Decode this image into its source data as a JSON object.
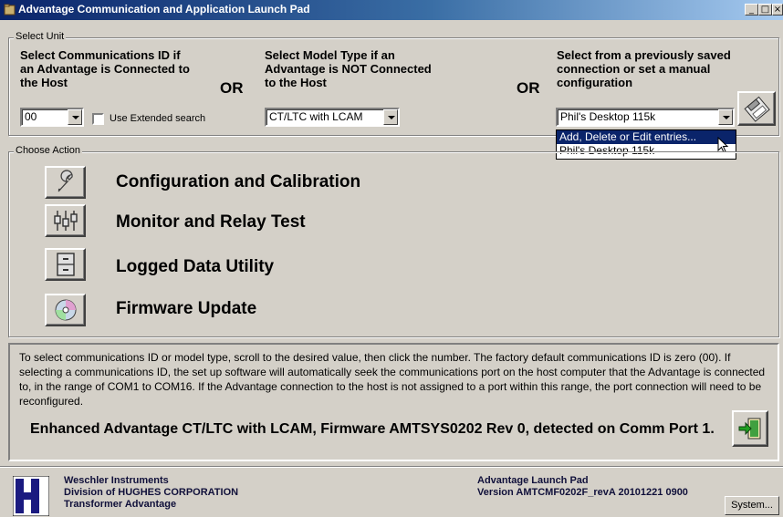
{
  "window": {
    "title": "Advantage Communication and Application Launch Pad",
    "controls": {
      "minimize": "_",
      "maximize": "□",
      "close": "×"
    }
  },
  "select_unit": {
    "legend": "Select Unit",
    "col1": {
      "heading": "Select Communications ID if an Advantage is Connected to the Host",
      "heading_lines": [
        "Select Communications ID if",
        "an Advantage is Connected to",
        "the Host"
      ],
      "value": "00",
      "checkbox_label": "Use Extended search",
      "checkbox_checked": false
    },
    "or1": "OR",
    "col2": {
      "heading_lines": [
        "Select Model Type if an",
        "Advantage is NOT Connected",
        "to the Host"
      ],
      "value": "CT/LTC with LCAM"
    },
    "or2": "OR",
    "col3": {
      "heading_lines": [
        "Select from a previously saved",
        "connection or set a manual",
        "configuration"
      ],
      "value": "Phil's Desktop 115k",
      "dropdown_options": [
        "Add, Delete or Edit entries...",
        "Phil's Desktop 115k"
      ],
      "dropdown_highlighted_index": 0,
      "save_icon": "diskette-icon"
    }
  },
  "choose_action": {
    "legend": "Choose Action",
    "actions": [
      {
        "label": "Configuration and Calibration",
        "icon": "wrench-icon"
      },
      {
        "label": "Monitor and Relay Test",
        "icon": "relay-icon"
      },
      {
        "label": "Logged Data Utility",
        "icon": "cabinet-icon"
      },
      {
        "label": "Firmware Update",
        "icon": "cd-icon"
      }
    ]
  },
  "info": {
    "text": "To select communications ID or model type, scroll to the desired value, then click the number. The factory default communications ID is zero (00). If selecting a communications ID, the set up software will automatically seek the communications port on the host computer that the Advantage is connected to, in the range of COM1 to COM16. If the Advantage connection to the host is not assigned to a port within this range, the port connection will need to be reconfigured.",
    "status": "Enhanced Advantage CT/LTC with LCAM, Firmware AMTSYS0202 Rev 0, detected on Comm Port 1.",
    "exit_icon": "exit-door-icon"
  },
  "footer": {
    "company_lines": [
      "Weschler Instruments",
      "Division of HUGHES CORPORATION",
      "Transformer Advantage"
    ],
    "app_lines": [
      "Advantage Launch Pad",
      "Version AMTCMF0202F_revA  20101221 0900"
    ],
    "system_button": "System..."
  },
  "colors": {
    "title_bar": "#0a246a",
    "face": "#d4d0c8",
    "selection": "#0a246a"
  }
}
